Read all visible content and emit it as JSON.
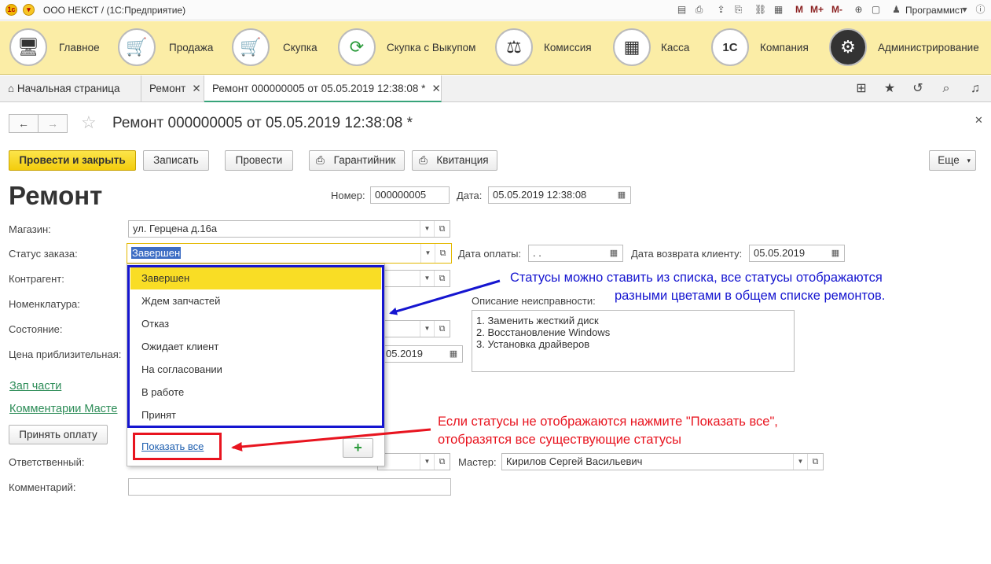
{
  "titlebar": {
    "title": "ООО НЕКСТ / (1С:Предприятие)",
    "m_labels": [
      "M",
      "M+",
      "M-"
    ],
    "user": "Программист"
  },
  "sections": [
    {
      "label": "Главное",
      "icon": "computer-icon"
    },
    {
      "label": "Продажа",
      "icon": "cart-up-icon"
    },
    {
      "label": "Скупка",
      "icon": "cart-down-icon"
    },
    {
      "label": "Скупка с Выкупом",
      "icon": "cycle-arrows-icon"
    },
    {
      "label": "Комиссия",
      "icon": "scales-icon"
    },
    {
      "label": "Касса",
      "icon": "cash-register-icon"
    },
    {
      "label": "Компания",
      "icon": "1c-logo-icon"
    },
    {
      "label": "Администрирование",
      "icon": "gears-icon"
    }
  ],
  "tabs": [
    {
      "label": "Начальная страница"
    },
    {
      "label": "Ремонт"
    },
    {
      "label": "Ремонт 000000005 от 05.05.2019 12:38:08 *"
    }
  ],
  "form": {
    "title": "Ремонт 000000005 от 05.05.2019 12:38:08 *",
    "heading": "Ремонт",
    "buttons": {
      "post_close": "Провести и закрыть",
      "save": "Записать",
      "post": "Провести",
      "warranty": "Гарантийник",
      "receipt": "Квитанция",
      "more": "Еще"
    },
    "number_label": "Номер:",
    "number": "000000005",
    "date_label": "Дата:",
    "date": "05.05.2019 12:38:08",
    "shop_label": "Магазин:",
    "shop": "ул. Герцена д.16а",
    "status_label": "Статус заказа:",
    "status": "Завершен",
    "pay_date_label": "Дата оплаты:",
    "pay_date": " .  .",
    "return_date_label": "Дата возврата клиенту:",
    "return_date": "05.05.2019",
    "contractor_label": "Контрагент:",
    "nomenclature_label": "Номенклатура:",
    "condition_label": "Состояние:",
    "price_label": "Цена приблизительная:",
    "partial_date": "05.2019",
    "malfunction_label": "Описание неисправности:",
    "malfunction_lines": [
      "1. Заменить жесткий диск",
      "2. Восстановление Windows",
      "3. Установка драйверов"
    ],
    "parts_link": "Зап части",
    "master_comments_link": "Комментарии Масте",
    "accept_payment": "Принять оплату",
    "responsible_label": "Ответственный:",
    "master_label": "Мастер:",
    "master": "Кирилов Сергей Васильевич",
    "comment_label": "Комментарий:"
  },
  "dropdown": {
    "options": [
      "Завершен",
      "Ждем запчастей",
      "Отказ",
      "Ожидает клиент",
      "На согласовании",
      "В работе",
      "Принят"
    ],
    "show_all": "Показать все",
    "add": "+"
  },
  "annotations": {
    "blue_line1": "Статусы можно ставить из списка, все статусы отображаются",
    "blue_line2": "разными цветами в общем списке ремонтов.",
    "red_line1": "Если статусы не отображаются нажмите \"Показать все\",",
    "red_line2": "отобразятся все существующие статусы"
  },
  "colors": {
    "accent_yellow": "#f3cd0d",
    "sections_bg": "#fbeda6",
    "annotation_blue": "#1515d0",
    "annotation_red": "#e8141f",
    "link_green": "#2c8c57"
  }
}
